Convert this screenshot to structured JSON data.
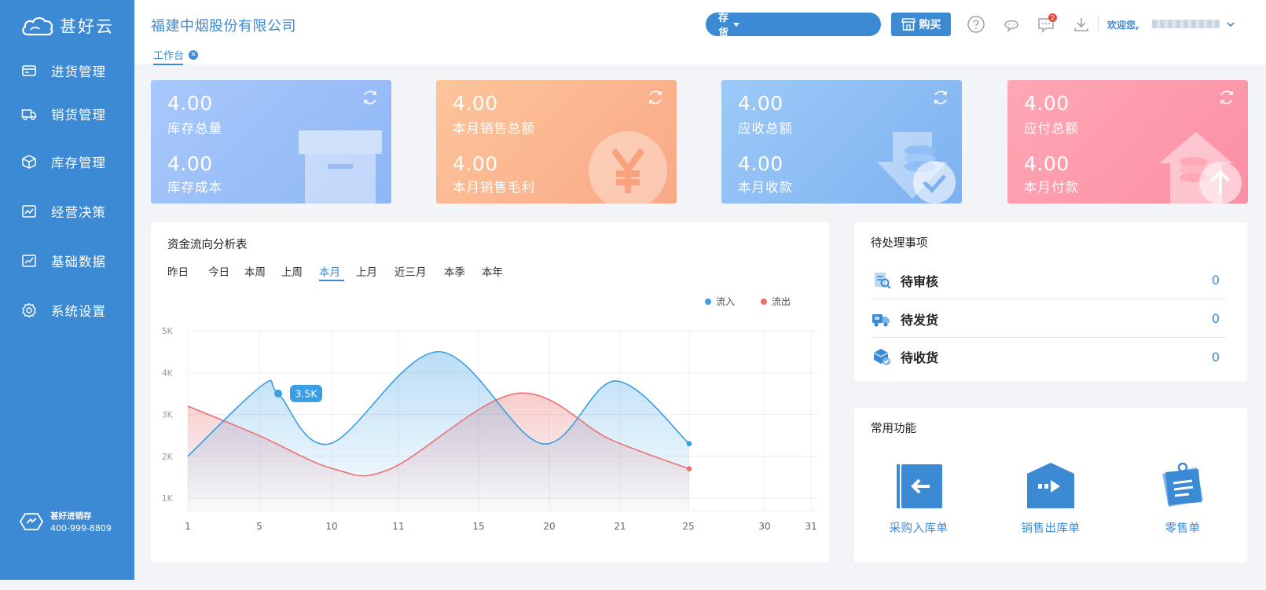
{
  "app": {
    "logo_text": "甚好云"
  },
  "sidebar": {
    "items": [
      {
        "label": "进货管理",
        "icon": "purchase-icon"
      },
      {
        "label": "销货管理",
        "icon": "truck-icon"
      },
      {
        "label": "库存管理",
        "icon": "box-icon"
      },
      {
        "label": "经营决策",
        "icon": "decision-chart-icon"
      },
      {
        "label": "基础数据",
        "icon": "data-chart-icon"
      },
      {
        "label": "系统设置",
        "icon": "gear-icon"
      }
    ],
    "contact": {
      "title": "甚好进销存",
      "phone": "400-999-8809"
    }
  },
  "header": {
    "company": "福建中烟股份有限公司",
    "tab_label": "工作台",
    "search": {
      "category": "存货",
      "value": "",
      "placeholder": ""
    },
    "buy_label": "购买",
    "message_badge": "2",
    "welcome_label": "欢迎您,"
  },
  "cards": [
    {
      "value1": "4.00",
      "label1": "库存总量",
      "value2": "4.00",
      "label2": "库存成本",
      "art": "archive-box-icon",
      "color_from": "#a7c8fb",
      "color_to": "#8fb6f5"
    },
    {
      "value1": "4.00",
      "label1": "本月销售总额",
      "value2": "4.00",
      "label2": "本月销售毛利",
      "art": "yen-coin-icon",
      "color_from": "#fdc59b",
      "color_to": "#f9a886"
    },
    {
      "value1": "4.00",
      "label1": "应收总额",
      "value2": "4.00",
      "label2": "本月收款",
      "art": "coin-check-icon",
      "color_from": "#9ccaf8",
      "color_to": "#7eb1f0"
    },
    {
      "value1": "4.00",
      "label1": "应付总额",
      "value2": "4.00",
      "label2": "本月付款",
      "art": "house-upload-icon",
      "color_from": "#ffa7b4",
      "color_to": "#fb8fa3"
    }
  ],
  "chart_panel": {
    "title": "资金流向分析表",
    "periods": [
      "昨日",
      "今日",
      "本周",
      "上周",
      "本月",
      "上月",
      "近三月",
      "本季",
      "本年"
    ],
    "active_period": "本月",
    "tooltip": "3.5K"
  },
  "chart_data": {
    "type": "area",
    "x_ticks": [
      "1",
      "5",
      "10",
      "11",
      "15",
      "20",
      "21",
      "25",
      "30",
      "31"
    ],
    "y_ticks": [
      "1K",
      "2K",
      "3K",
      "4K",
      "5K"
    ],
    "ylim": [
      1000,
      5000
    ],
    "legend_position": "top-right",
    "series": [
      {
        "name": "流入",
        "color": "#3a9ee4",
        "values": [
          2000,
          3700,
          3500,
          2300,
          4500,
          2300,
          3800,
          2300
        ]
      },
      {
        "name": "流出",
        "color": "#ec7070",
        "values": [
          3200,
          2500,
          1700,
          1700,
          3500,
          2400,
          1700
        ]
      }
    ]
  },
  "pending": {
    "title": "待处理事项",
    "items": [
      {
        "label": "待审核",
        "count": "0",
        "icon": "review-icon"
      },
      {
        "label": "待发货",
        "count": "0",
        "icon": "delivery-truck-icon"
      },
      {
        "label": "待收货",
        "count": "0",
        "icon": "receive-box-icon"
      }
    ]
  },
  "functions": {
    "title": "常用功能",
    "items": [
      {
        "label": "采购入库单",
        "icon": "purchase-inbound-icon"
      },
      {
        "label": "销售出库单",
        "icon": "sales-outbound-icon"
      },
      {
        "label": "零售单",
        "icon": "retail-receipt-icon"
      }
    ]
  }
}
